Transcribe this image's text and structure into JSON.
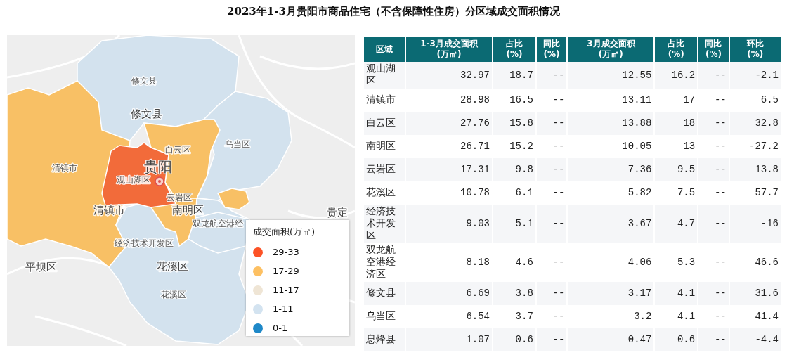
{
  "title": "2023年1-3月贵阳市商品住宅（不含保障性住房）分区域成交面积情况",
  "map": {
    "regions": [
      {
        "color": "#d3e2ee"
      },
      {
        "color": "#f8c065"
      },
      {
        "color": "#d3e2ee"
      },
      {
        "color": "#d3e2ee"
      },
      {
        "color": "#f8c065"
      },
      {
        "color": "#f8c065"
      },
      {
        "color": "#f8c065"
      },
      {
        "color": "#d3e2ee"
      },
      {
        "color": "#f26b3a"
      }
    ],
    "labels": [
      {
        "text": "修文县",
        "kind": "minor"
      },
      {
        "text": "修文县",
        "kind": "major"
      },
      {
        "text": "乌当区",
        "kind": "minor"
      },
      {
        "text": "白云区",
        "kind": "minor"
      },
      {
        "text": "清镇市",
        "kind": "minor"
      },
      {
        "text": "贵阳",
        "kind": "city"
      },
      {
        "text": "观山湖区",
        "kind": "minor"
      },
      {
        "text": "云岩区",
        "kind": "minor"
      },
      {
        "text": "清镇市",
        "kind": "major"
      },
      {
        "text": "南明区",
        "kind": "major"
      },
      {
        "text": "双龙航空港经",
        "kind": "minor"
      },
      {
        "text": "经济技术开发区",
        "kind": "minor"
      },
      {
        "text": "花溪区",
        "kind": "major"
      },
      {
        "text": "花溪区",
        "kind": "minor"
      },
      {
        "text": "平坝区",
        "kind": "major"
      },
      {
        "text": "贵定",
        "kind": "major"
      }
    ],
    "legend": {
      "title": "成交面积(万㎡)",
      "items": [
        {
          "label": "29-33",
          "color": "#fc5226"
        },
        {
          "label": "17-29",
          "color": "#fdc062"
        },
        {
          "label": "11-17",
          "color": "#efe5d5"
        },
        {
          "label": "1-11",
          "color": "#d3e3f0"
        },
        {
          "label": "0-1",
          "color": "#1e88c8"
        }
      ]
    }
  },
  "table": {
    "columns": [
      "区域",
      "1-3月成交面积\n(万㎡)",
      "占比\n(%)",
      "同比\n(%)",
      "3月成交面积\n(万㎡)",
      "占比\n(%)",
      "同比\n(%)",
      "环比\n(%)"
    ],
    "rows": [
      [
        "观山湖区",
        "32.97",
        "18.7",
        "--",
        "12.55",
        "16.2",
        "--",
        "-2.1"
      ],
      [
        "清镇市",
        "28.98",
        "16.5",
        "--",
        "13.11",
        "17",
        "--",
        "6.5"
      ],
      [
        "白云区",
        "27.76",
        "15.8",
        "--",
        "13.88",
        "18",
        "--",
        "32.8"
      ],
      [
        "南明区",
        "26.71",
        "15.2",
        "--",
        "10.05",
        "13",
        "--",
        "-27.2"
      ],
      [
        "云岩区",
        "17.31",
        "9.8",
        "--",
        "7.36",
        "9.5",
        "--",
        "13.8"
      ],
      [
        "花溪区",
        "10.78",
        "6.1",
        "--",
        "5.82",
        "7.5",
        "--",
        "57.7"
      ],
      [
        "经济技术开发区",
        "9.03",
        "5.1",
        "--",
        "3.67",
        "4.7",
        "--",
        "-16"
      ],
      [
        "双龙航空港经济区",
        "8.18",
        "4.6",
        "--",
        "4.06",
        "5.3",
        "--",
        "46.6"
      ],
      [
        "修文县",
        "6.69",
        "3.8",
        "--",
        "3.17",
        "4.1",
        "--",
        "31.6"
      ],
      [
        "乌当区",
        "6.54",
        "3.7",
        "--",
        "3.2",
        "4.1",
        "--",
        "41.4"
      ],
      [
        "息烽县",
        "1.07",
        "0.6",
        "--",
        "0.47",
        "0.6",
        "--",
        "-4.4"
      ]
    ]
  }
}
